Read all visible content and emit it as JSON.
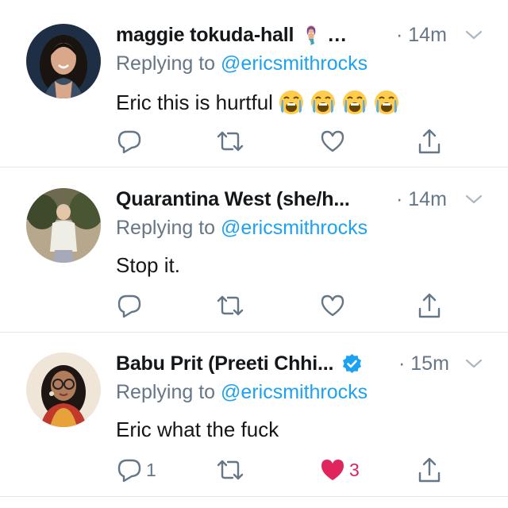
{
  "colors": {
    "muted": "#657786",
    "link": "#1da1f2",
    "like": "#e0245e",
    "divider": "#e1e8ed"
  },
  "tweets": [
    {
      "name": "maggie tokuda-hall",
      "name_emoji": "mermaid-emoji",
      "name_ellipsis": "…",
      "time": "· 14m",
      "reply_prefix": "Replying to ",
      "reply_handle": "@ericsmithrocks",
      "text": "Eric this is hurtful",
      "emojis": [
        "loudly-crying-face",
        "loudly-crying-face",
        "loudly-crying-face",
        "loudly-crying-face"
      ],
      "reply_count": "",
      "like_count": "",
      "liked": false
    },
    {
      "name": "Quarantina West (she/h...",
      "time": "· 14m",
      "reply_prefix": "Replying to ",
      "reply_handle": "@ericsmithrocks",
      "text": "Stop it.",
      "reply_count": "",
      "like_count": "",
      "liked": false
    },
    {
      "name": "Babu Prit (Preeti Chhi...",
      "verified": true,
      "time": "· 15m",
      "reply_prefix": "Replying to ",
      "reply_handle": "@ericsmithrocks",
      "text": "Eric what the fuck",
      "reply_count": "1",
      "like_count": "3",
      "liked": true
    }
  ]
}
